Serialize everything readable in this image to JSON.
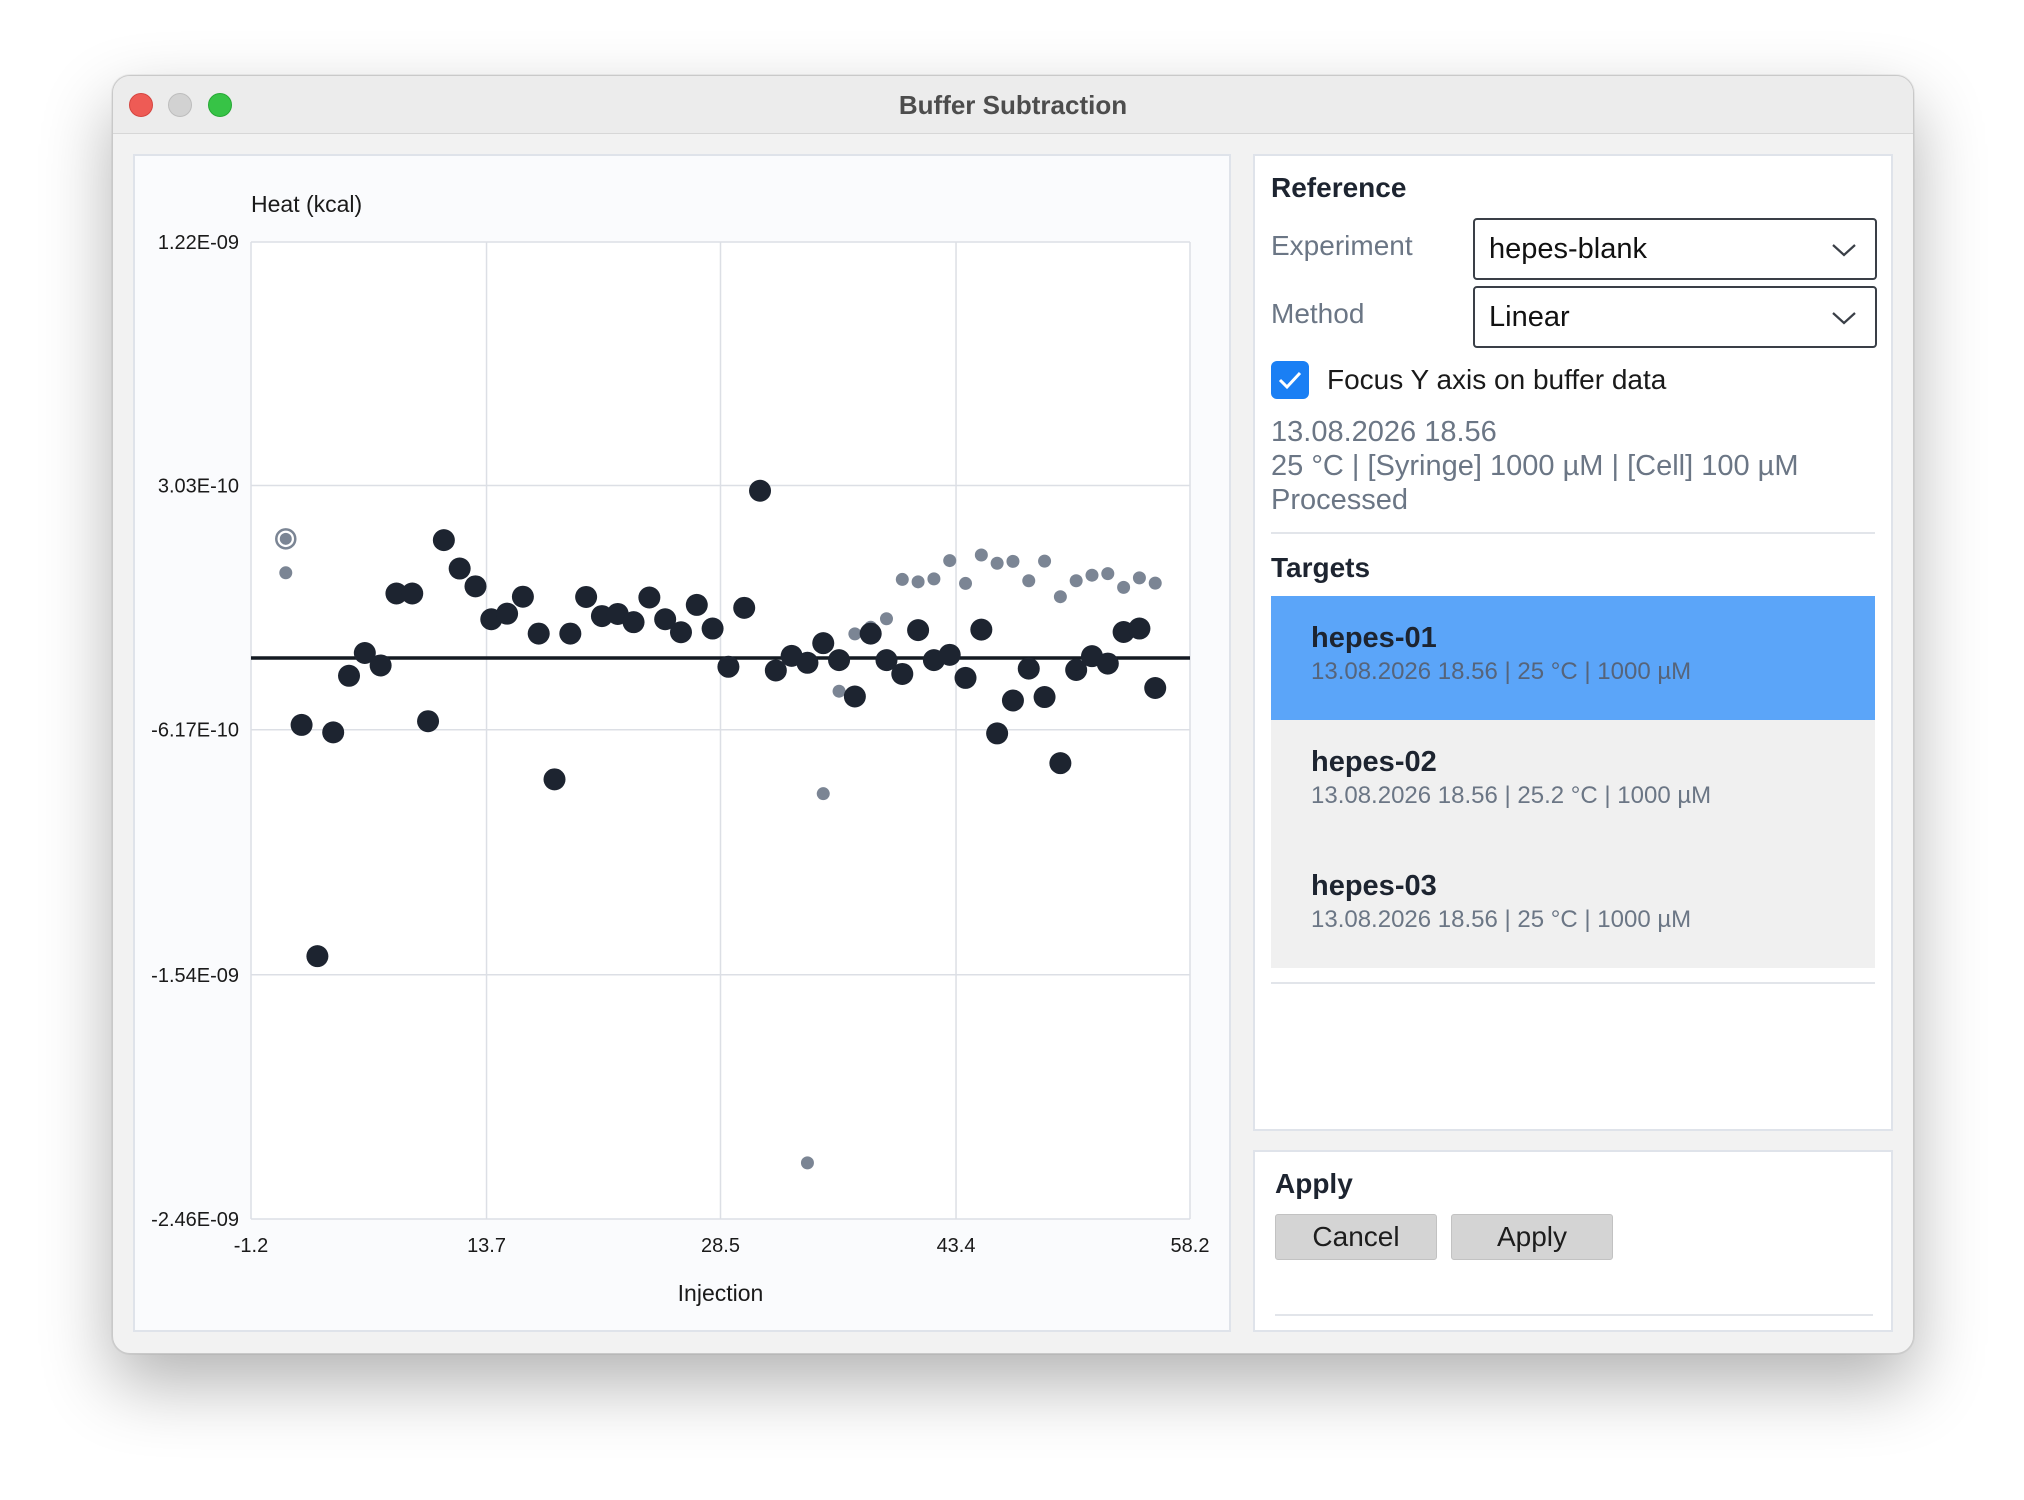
{
  "window": {
    "title": "Buffer Subtraction"
  },
  "reference": {
    "heading": "Reference",
    "experiment_label": "Experiment",
    "experiment_value": "hepes-blank",
    "method_label": "Method",
    "method_value": "Linear",
    "focus_checkbox_label": "Focus Y axis on buffer data",
    "focus_checked": true,
    "info_date": "13.08.2026 18.56",
    "info_conditions": "25 °C | [Syringe] 1000 µM | [Cell] 100 µM",
    "info_status": "Processed"
  },
  "targets": {
    "heading": "Targets",
    "items": [
      {
        "name": "hepes-01",
        "meta": "13.08.2026 18.56 | 25 °C | 1000 µM",
        "selected": true
      },
      {
        "name": "hepes-02",
        "meta": "13.08.2026 18.56 | 25.2 °C | 1000 µM",
        "selected": false
      },
      {
        "name": "hepes-03",
        "meta": "13.08.2026 18.56 | 25 °C | 1000 µM",
        "selected": false
      }
    ]
  },
  "apply": {
    "heading": "Apply",
    "cancel_label": "Cancel",
    "apply_label": "Apply"
  },
  "colors": {
    "accent": "#1a7ff4",
    "selected_row": "#5ba5f9",
    "primary_points": "#1d2430",
    "secondary_points": "#7b8594"
  },
  "chart_data": {
    "type": "scatter",
    "ylabel": "Heat (kcal)",
    "xlabel": "Injection",
    "xlim": [
      -1.2,
      58.2
    ],
    "ylim": [
      -2.46e-09,
      1.22e-09
    ],
    "x_ticks": [
      -1.2,
      13.7,
      28.5,
      43.4,
      58.2
    ],
    "x_tick_labels": [
      "-1.2",
      "13.7",
      "28.5",
      "43.4",
      "58.2"
    ],
    "y_ticks": [
      1.22e-09,
      3.03e-10,
      -6.17e-10,
      -1.54e-09,
      -2.46e-09
    ],
    "y_tick_labels": [
      "1.22E-09",
      "3.03E-10",
      "-6.17E-10",
      "-1.54E-09",
      "-2.46E-09"
    ],
    "grid": true,
    "reference_line": {
      "y": -3.47e-10
    },
    "series": [
      {
        "role": "target",
        "x": [
          2,
          3,
          4,
          5,
          6,
          7,
          8,
          9,
          10,
          11,
          12,
          13,
          14,
          15,
          16,
          17,
          18,
          19,
          20,
          21,
          22,
          23,
          24,
          25,
          26,
          27,
          28,
          29,
          30,
          31,
          32,
          33,
          34,
          35,
          36,
          37,
          38,
          39,
          40,
          41,
          42,
          43,
          44,
          45,
          46,
          47,
          48,
          49,
          50,
          51,
          52,
          53,
          54,
          55,
          56
        ],
        "y": [
          -5.99e-10,
          -1.47e-09,
          -6.27e-10,
          -4.14e-10,
          -3.28e-10,
          -3.75e-10,
          -1.04e-10,
          -1.04e-10,
          -5.85e-10,
          9.7e-11,
          -1e-11,
          -7.7e-11,
          -2.01e-10,
          -1.8e-10,
          -1.16e-10,
          -2.55e-10,
          -8.04e-10,
          -2.55e-10,
          -1.17e-10,
          -1.89e-10,
          -1.81e-10,
          -2.12e-10,
          -1.19e-10,
          -2.01e-10,
          -2.5e-10,
          -1.47e-10,
          -2.36e-10,
          -3.8e-10,
          -1.58e-10,
          2.83e-10,
          -3.94e-10,
          -3.39e-10,
          -3.65e-10,
          -2.91e-10,
          -3.55e-10,
          -4.92e-10,
          -2.55e-10,
          -3.55e-10,
          -4.07e-10,
          -2.42e-10,
          -3.55e-10,
          -3.35e-10,
          -4.22e-10,
          -2.4e-10,
          -6.31e-10,
          -5.07e-10,
          -3.87e-10,
          -4.94e-10,
          -7.43e-10,
          -3.92e-10,
          -3.4e-10,
          -3.68e-10,
          -2.49e-10,
          -2.36e-10,
          -4.6e-10
        ]
      },
      {
        "role": "buffer",
        "x": [
          1,
          34,
          35,
          36,
          37,
          38,
          39,
          40,
          41,
          42,
          43,
          44,
          45,
          46,
          47,
          48,
          49,
          50,
          51,
          52,
          53,
          54,
          55,
          56
        ],
        "y": [
          -2.6e-11,
          -2.2486e-09,
          -8.58e-10,
          -4.72e-10,
          -2.56e-10,
          -2.31e-10,
          -1.99e-10,
          -5.1e-11,
          -6e-11,
          -4.9e-11,
          2e-11,
          -6.6e-11,
          4.1e-11,
          1e-11,
          1.7e-11,
          -5.6e-11,
          1.8e-11,
          -1.16e-10,
          -5.6e-11,
          -3.5e-11,
          -2.9e-11,
          -8.1e-11,
          -4.5e-11,
          -6.5e-11
        ]
      }
    ],
    "highlighted_point": {
      "x": 1,
      "y": 1.02e-10
    }
  }
}
